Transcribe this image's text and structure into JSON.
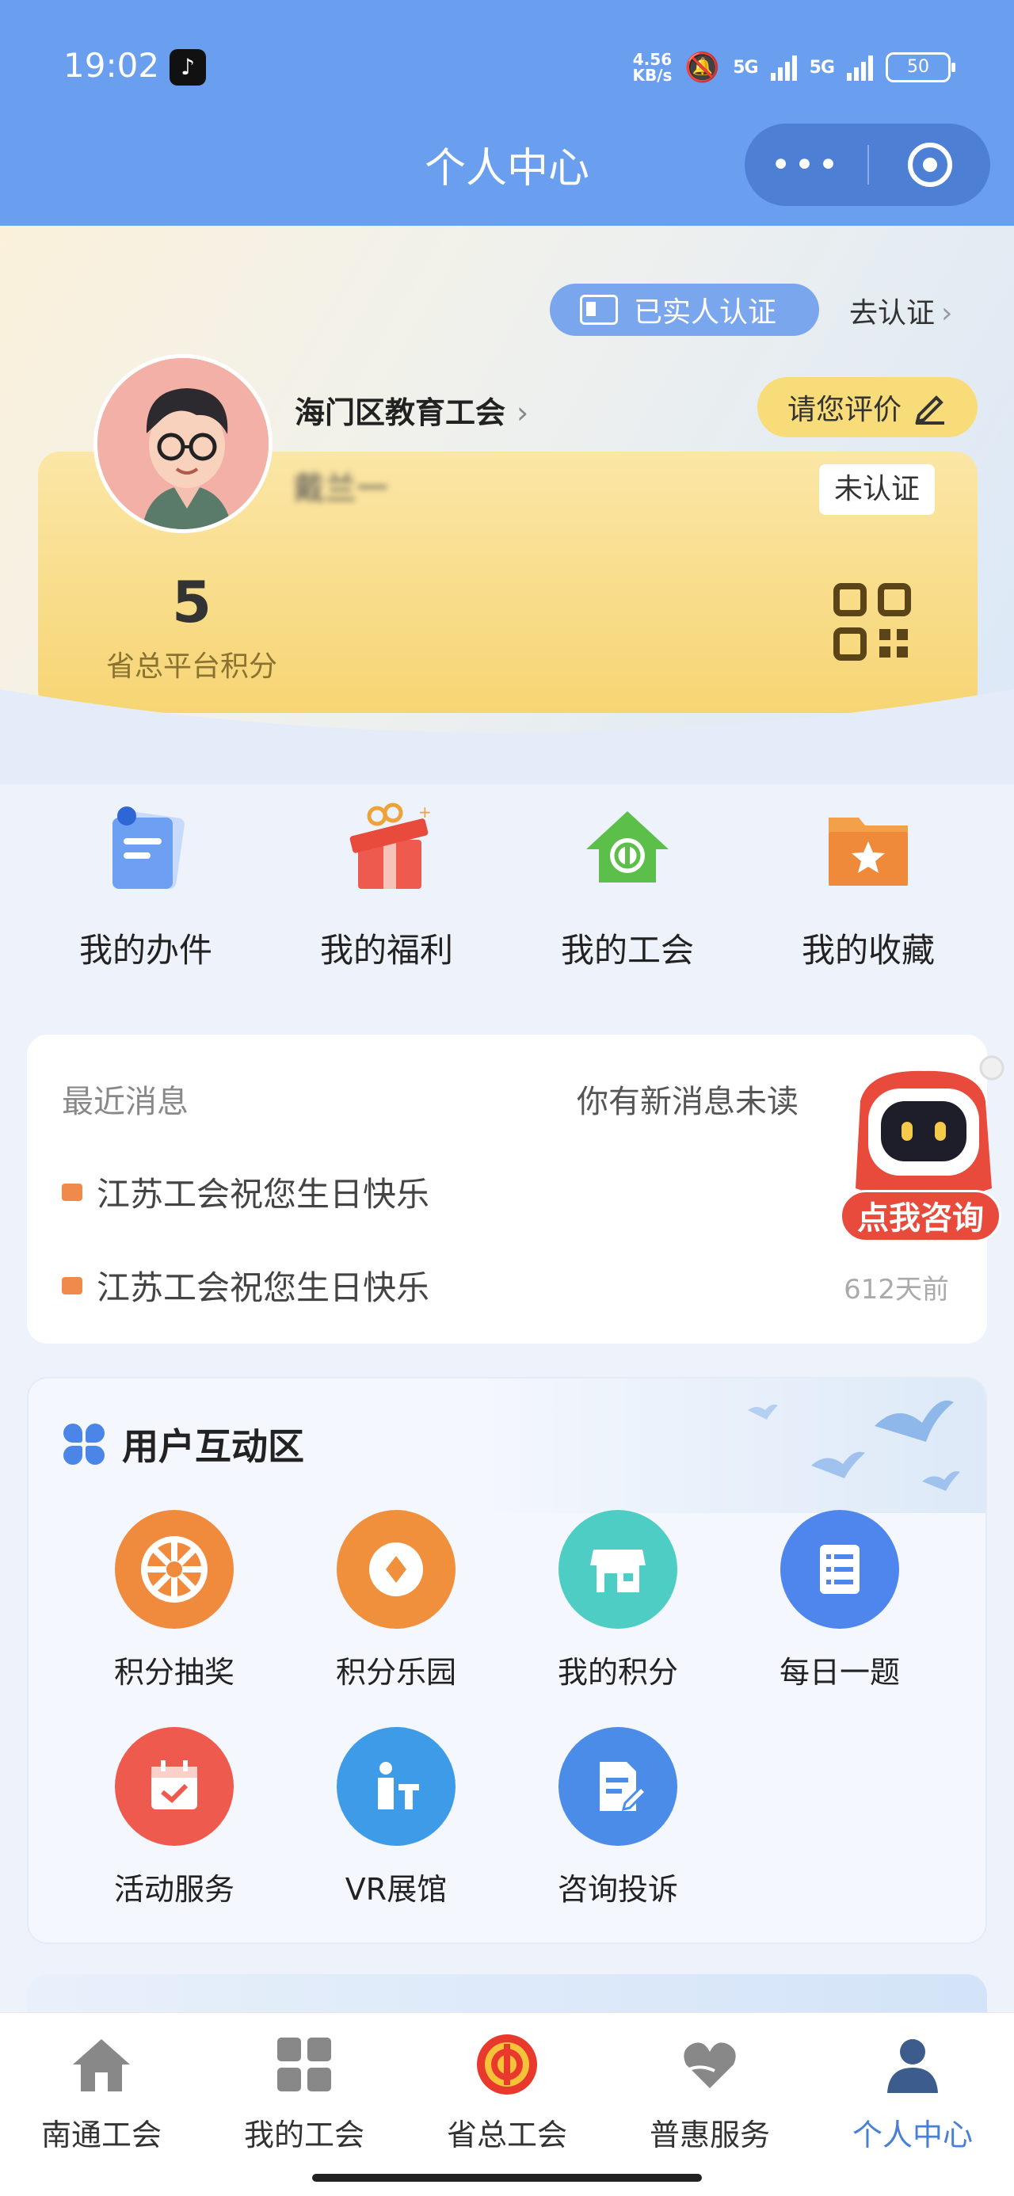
{
  "status_bar": {
    "time": "19:02",
    "net_speed_top": "4.56",
    "net_speed_bottom": "KB/s",
    "sim1": "5G",
    "sim2": "5G",
    "battery": "50"
  },
  "header": {
    "title": "个人中心",
    "more_label": "•••"
  },
  "profile": {
    "verified_label": "已实人认证",
    "go_verify_label": "去认证",
    "union_name": "海门区教育工会",
    "rate_label": "请您评价",
    "user_name": "戴兰一",
    "unverified_tag": "未认证",
    "points_value": "5",
    "points_label": "省总平台积分"
  },
  "quick_links": [
    {
      "label": "我的办件",
      "icon": "document-icon"
    },
    {
      "label": "我的福利",
      "icon": "gift-icon"
    },
    {
      "label": "我的工会",
      "icon": "union-home-icon"
    },
    {
      "label": "我的收藏",
      "icon": "star-folder-icon"
    }
  ],
  "messages": {
    "title": "最近消息",
    "unread_label": "你有新消息未读",
    "items": [
      {
        "text": "江苏工会祝您生日快乐"
      },
      {
        "text": "江苏工会祝您生日快乐",
        "time": "612天前"
      }
    ]
  },
  "assistant": {
    "label": "点我咨询"
  },
  "interaction": {
    "title": "用户互动区",
    "items": [
      {
        "label": "积分抽奖",
        "icon": "lottery-wheel-icon",
        "color": "#f08a3c"
      },
      {
        "label": "积分乐园",
        "icon": "coin-icon",
        "color": "#f0903c"
      },
      {
        "label": "我的积分",
        "icon": "shop-icon",
        "color": "#4ecdc4"
      },
      {
        "label": "每日一题",
        "icon": "checklist-icon",
        "color": "#4f86ee"
      },
      {
        "label": "活动服务",
        "icon": "calendar-check-icon",
        "color": "#ef5a4e"
      },
      {
        "label": "VR展馆",
        "icon": "exhibition-icon",
        "color": "#3e9be8"
      },
      {
        "label": "咨询投诉",
        "icon": "form-edit-icon",
        "color": "#4b8ce8"
      }
    ]
  },
  "tabbar": [
    {
      "label": "南通工会",
      "icon": "home-icon"
    },
    {
      "label": "我的工会",
      "icon": "grid-icon"
    },
    {
      "label": "省总工会",
      "icon": "union-emblem-icon"
    },
    {
      "label": "普惠服务",
      "icon": "heart-hand-icon"
    },
    {
      "label": "个人中心",
      "icon": "person-icon",
      "active": true
    }
  ],
  "colors": {
    "header_blue": "#6a9ff0",
    "accent_blue": "#4a7fd6",
    "card_yellow": "#f7d574"
  }
}
